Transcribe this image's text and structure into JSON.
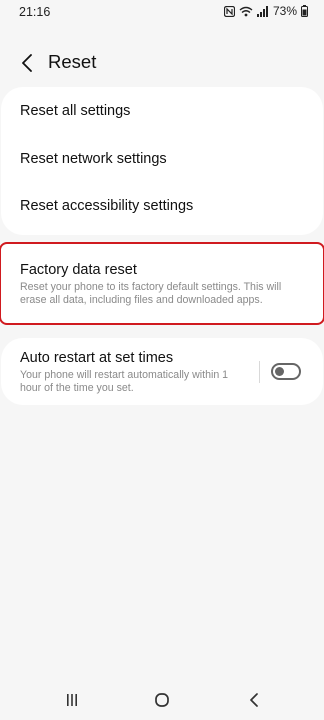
{
  "status_bar": {
    "time": "21:16",
    "battery": "73%"
  },
  "header": {
    "title": "Reset"
  },
  "reset_group": {
    "items": [
      {
        "label": "Reset all settings"
      },
      {
        "label": "Reset network settings"
      },
      {
        "label": "Reset accessibility settings"
      }
    ]
  },
  "factory_reset": {
    "title": "Factory data reset",
    "description": "Reset your phone to its factory default settings. This will erase all data, including files and downloaded apps."
  },
  "auto_restart": {
    "title": "Auto restart at set times",
    "description": "Your phone will restart automatically within 1 hour of the time you set.",
    "enabled": false
  },
  "icons": {
    "back": "chevron-left-icon",
    "nfc": "nfc-icon",
    "wifi": "wifi-icon",
    "signal": "signal-icon",
    "battery": "battery-icon",
    "recents": "recents-icon",
    "home": "home-icon",
    "nav_back": "nav-back-icon"
  },
  "colors": {
    "highlight": "#d01a1f",
    "background": "#f6f6f6",
    "card": "#ffffff",
    "toggle_off": "#666666"
  }
}
